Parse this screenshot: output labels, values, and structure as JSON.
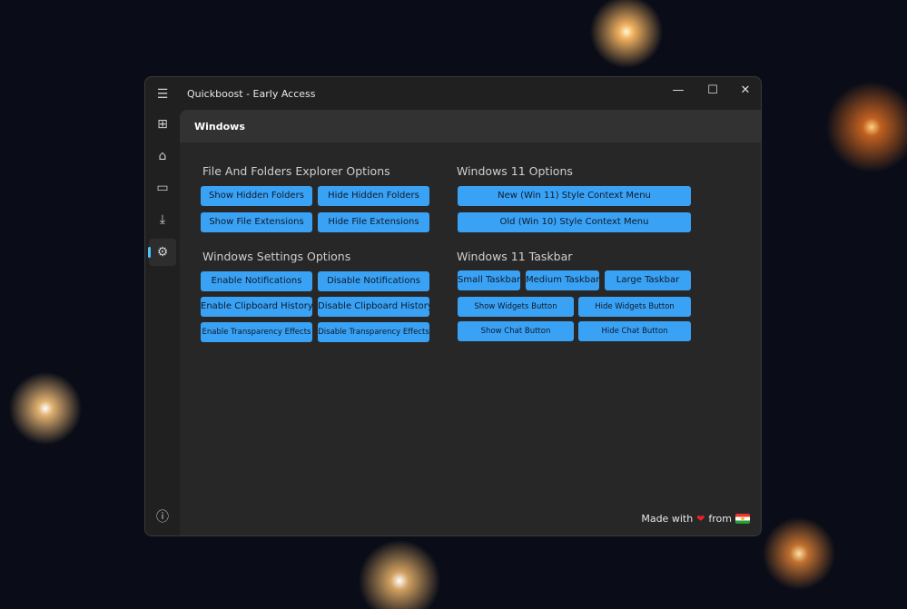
{
  "window": {
    "title": "Quickboost - Early Access",
    "minimize": "—",
    "maximize": "☐",
    "close": "✕"
  },
  "sidebar": {
    "menu": "☰",
    "items": [
      {
        "name": "apps",
        "glyph": "⊞"
      },
      {
        "name": "toolbox",
        "glyph": "⌂"
      },
      {
        "name": "drive",
        "glyph": "▭"
      },
      {
        "name": "download",
        "glyph": "⤓"
      },
      {
        "name": "windows-settings",
        "glyph": "⚙"
      }
    ],
    "info": "ⓘ"
  },
  "page": {
    "header": "Windows"
  },
  "sections": {
    "explorer": {
      "title": "File And Folders Explorer Options",
      "buttons": [
        "Show Hidden Folders",
        "Hide Hidden Folders",
        "Show File Extensions",
        "Hide File Extensions"
      ]
    },
    "settings": {
      "title": "Windows Settings Options",
      "buttons": [
        "Enable Notifications",
        "Disable Notifications",
        "Enable Clipboard History",
        "Disable Clipboard History",
        "Enable Transparency Effects",
        "Disable Transparency Effects"
      ]
    },
    "win11": {
      "title": "Windows 11 Options",
      "buttons": [
        "New (Win 11) Style Context Menu",
        "Old (Win 10) Style Context Menu"
      ]
    },
    "taskbar": {
      "title": "Windows 11 Taskbar",
      "buttons": [
        "Small Taskbar",
        "Medium Taskbar",
        "Large Taskbar",
        "Show Widgets Button",
        "Hide Widgets Button",
        "Show Chat Button",
        "Hide Chat Button"
      ]
    }
  },
  "footer": {
    "made_with": "Made with",
    "heart": "❤",
    "from": "from"
  }
}
